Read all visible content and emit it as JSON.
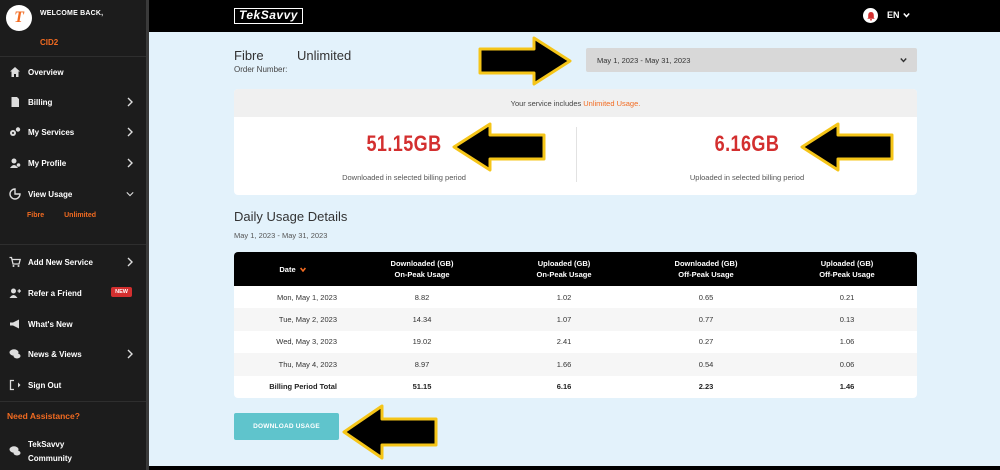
{
  "sidebar": {
    "welcome": "WELCOME BACK,",
    "user": "CID2",
    "items": [
      {
        "label": "Overview",
        "icon": "home-icon"
      },
      {
        "label": "Billing",
        "icon": "document-icon"
      },
      {
        "label": "My Services",
        "icon": "gears-icon"
      },
      {
        "label": "My Profile",
        "icon": "profile-icon"
      },
      {
        "label": "View Usage",
        "icon": "pie-chart-icon"
      },
      {
        "label": "Add New Service",
        "icon": "cart-icon"
      },
      {
        "label": "Refer a Friend",
        "icon": "user-plus-icon"
      },
      {
        "label": "What's New",
        "icon": "megaphone-icon"
      },
      {
        "label": "News & Views",
        "icon": "chat-bubbles-icon"
      },
      {
        "label": "Sign Out",
        "icon": "sign-out-icon"
      }
    ],
    "sub_items": [
      "Fibre",
      "Unlimited"
    ],
    "new_badge": "NEW",
    "assistance": "Need Assistance?",
    "community_line1": "TekSavvy",
    "community_line2": "Community"
  },
  "topbar": {
    "brand": "TekSavvy",
    "language": "EN"
  },
  "service": {
    "type": "Fibre",
    "plan": "Unlimited",
    "order_label": "Order Number:"
  },
  "period_select": {
    "value": "May 1, 2023 - May 31, 2023"
  },
  "summary": {
    "notice_prefix": "Your service includes",
    "notice_highlight": "Unlimited Usage.",
    "downloaded_value": "51.15GB",
    "downloaded_label": "Downloaded in selected billing period",
    "uploaded_value": "6.16GB",
    "uploaded_label": "Uploaded in selected billing period"
  },
  "daily": {
    "title": "Daily Usage Details",
    "range": "May 1, 2023 - May 31, 2023"
  },
  "table": {
    "headers": {
      "date": "Date",
      "dl_on_1": "Downloaded (GB)",
      "dl_on_2": "On-Peak Usage",
      "ul_on_1": "Uploaded (GB)",
      "ul_on_2": "On-Peak Usage",
      "dl_off_1": "Downloaded (GB)",
      "dl_off_2": "Off-Peak Usage",
      "ul_off_1": "Uploaded (GB)",
      "ul_off_2": "Off-Peak Usage"
    },
    "rows": [
      {
        "date": "Mon, May 1, 2023",
        "dl_on": "8.82",
        "ul_on": "1.02",
        "dl_off": "0.65",
        "ul_off": "0.21"
      },
      {
        "date": "Tue, May 2, 2023",
        "dl_on": "14.34",
        "ul_on": "1.07",
        "dl_off": "0.77",
        "ul_off": "0.13"
      },
      {
        "date": "Wed, May 3, 2023",
        "dl_on": "19.02",
        "ul_on": "2.41",
        "dl_off": "0.27",
        "ul_off": "1.06"
      },
      {
        "date": "Thu, May 4, 2023",
        "dl_on": "8.97",
        "ul_on": "1.66",
        "dl_off": "0.54",
        "ul_off": "0.06"
      }
    ],
    "total": {
      "label": "Billing Period Total",
      "dl_on": "51.15",
      "ul_on": "6.16",
      "dl_off": "2.23",
      "ul_off": "1.46"
    }
  },
  "download_button": "DOWNLOAD USAGE",
  "colors": {
    "accent": "#f26b21",
    "stat_red": "#d32f2f",
    "button_teal": "#5fc4cc",
    "arrow_fill": "#000000",
    "arrow_outline": "#f5c518"
  }
}
